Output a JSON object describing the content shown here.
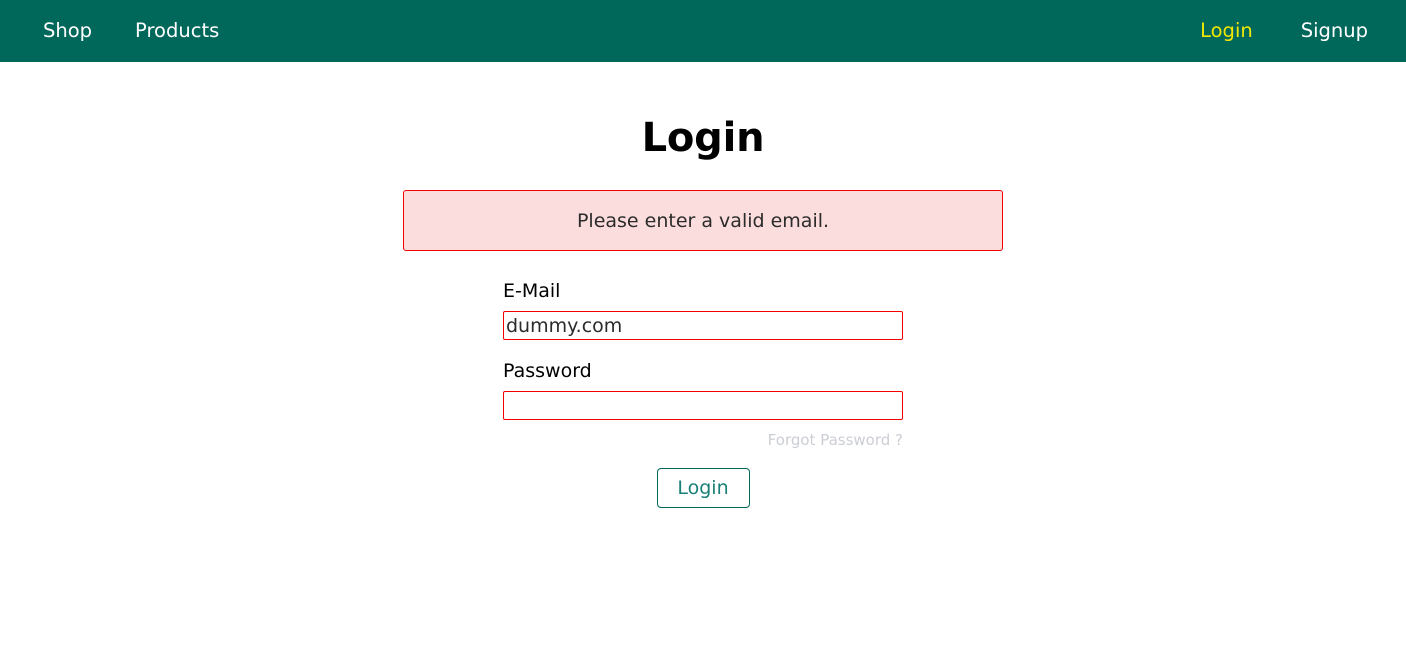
{
  "navbar": {
    "background_color": "#00675b",
    "left_links": [
      {
        "label": "Shop",
        "active": false
      },
      {
        "label": "Products",
        "active": false
      }
    ],
    "right_links": [
      {
        "label": "Login",
        "active": true,
        "color": "#f0e800"
      },
      {
        "label": "Signup",
        "active": false,
        "color": "#ffffff"
      }
    ]
  },
  "main": {
    "title": "Login",
    "error": {
      "message": "Please enter a valid email.",
      "background_color": "#fbdddd",
      "border_color": "#f40000"
    },
    "form": {
      "email": {
        "label": "E-Mail",
        "value": "dummy.com",
        "placeholder": "",
        "invalid": true,
        "border_color": "#f40000"
      },
      "password": {
        "label": "Password",
        "value": "",
        "placeholder": "",
        "invalid": true,
        "border_color": "#f40000"
      },
      "forgot_password_label": "Forgot Password ?",
      "forgot_password_color": "#cbced4",
      "submit_label": "Login",
      "submit_color": "#1a7f77"
    }
  }
}
